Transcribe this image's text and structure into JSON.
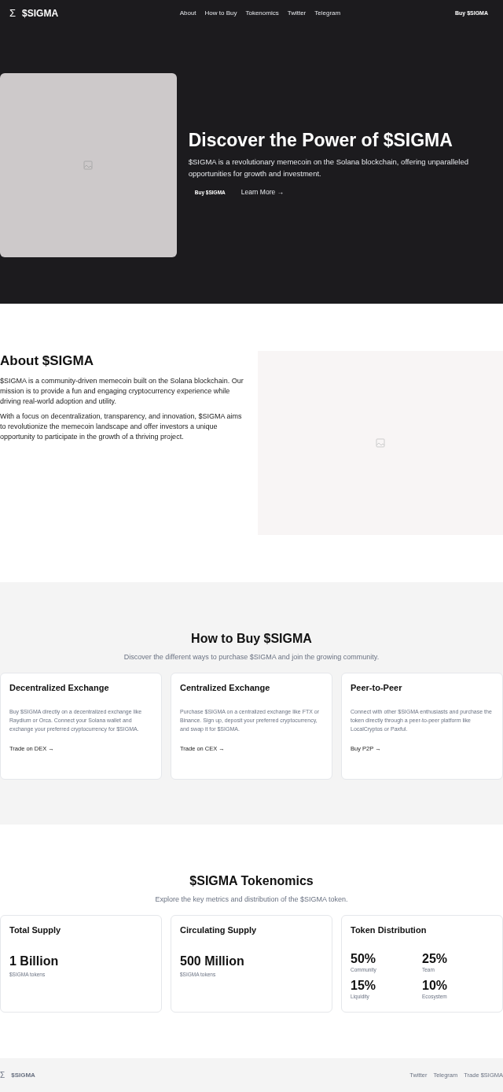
{
  "header": {
    "logo_symbol": "Σ",
    "logo_text": "$SIGMA",
    "nav": [
      "About",
      "How to Buy",
      "Tokenomics",
      "Twitter",
      "Telegram"
    ],
    "cta": "Buy $SIGMA"
  },
  "hero": {
    "title": "Discover the Power of $SIGMA",
    "text": "$SIGMA is a revolutionary memecoin on the Solana blockchain, offering unparalleled opportunities for growth and investment.",
    "primary_button": "Buy $SIGMA",
    "secondary_link": "Learn More",
    "link_arrow": "→"
  },
  "about": {
    "title": "About $SIGMA",
    "paragraphs": [
      "$SIGMA is a community-driven memecoin built on the Solana blockchain. Our mission is to provide a fun and engaging cryptocurrency experience while driving real-world adoption and utility.",
      "With a focus on decentralization, transparency, and innovation, $SIGMA aims to revolutionize the memecoin landscape and offer investors a unique opportunity to participate in the growth of a thriving project."
    ]
  },
  "how_to_buy": {
    "title": "How to Buy $SIGMA",
    "subtitle": "Discover the different ways to purchase $SIGMA and join the growing community.",
    "cards": [
      {
        "title": "Decentralized Exchange",
        "text": "Buy $SIGMA directly on a decentralized exchange like Raydium or Orca. Connect your Solana wallet and exchange your preferred cryptocurrency for $SIGMA.",
        "link": "Trade on DEX",
        "arrow": "→"
      },
      {
        "title": "Centralized Exchange",
        "text": "Purchase $SIGMA on a centralized exchange like FTX or Binance. Sign up, deposit your preferred cryptocurrency, and swap it for $SIGMA.",
        "link": "Trade on CEX",
        "arrow": "→"
      },
      {
        "title": "Peer-to-Peer",
        "text": "Connect with other $SIGMA enthusiasts and purchase the token directly through a peer-to-peer platform like LocalCryptos or Paxful.",
        "link": "Buy P2P",
        "arrow": "→"
      }
    ]
  },
  "tokenomics": {
    "title": "$SIGMA Tokenomics",
    "subtitle": "Explore the key metrics and distribution of the $SIGMA token.",
    "cards": [
      {
        "kind": "single",
        "title": "Total Supply",
        "value": "1 Billion",
        "caption": "$SIGMA tokens"
      },
      {
        "kind": "single",
        "title": "Circulating Supply",
        "value": "500 Million",
        "caption": "$SIGMA tokens"
      },
      {
        "kind": "grid",
        "title": "Token Distribution",
        "items": [
          {
            "value": "50%",
            "caption": "Community"
          },
          {
            "value": "25%",
            "caption": "Team"
          },
          {
            "value": "15%",
            "caption": "Liquidity"
          },
          {
            "value": "10%",
            "caption": "Ecosystem"
          }
        ]
      }
    ]
  },
  "footer": {
    "logo_symbol": "Σ",
    "logo_text": "$SIGMA",
    "links": [
      "Twitter",
      "Telegram",
      "Trade $SIGMA"
    ]
  }
}
